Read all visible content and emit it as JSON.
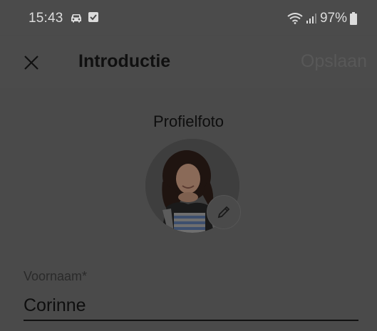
{
  "status_bar": {
    "time": "15:43",
    "battery_percent": "97%",
    "icons": [
      "car-icon",
      "check-box-icon",
      "wifi-icon",
      "signal-icon",
      "battery-icon"
    ]
  },
  "app_bar": {
    "title": "Introductie",
    "save_label": "Opslaan",
    "close_icon": "close-icon"
  },
  "profile": {
    "photo_label": "Profielfoto",
    "edit_icon": "pencil-icon"
  },
  "form": {
    "first_name_label": "Voornaam*",
    "first_name_value": "Corinne"
  },
  "colors": {
    "overlay_background": "#4b4b4b",
    "text_primary": "#101010",
    "text_disabled": "#585858",
    "status_text": "#dcdcdc"
  }
}
